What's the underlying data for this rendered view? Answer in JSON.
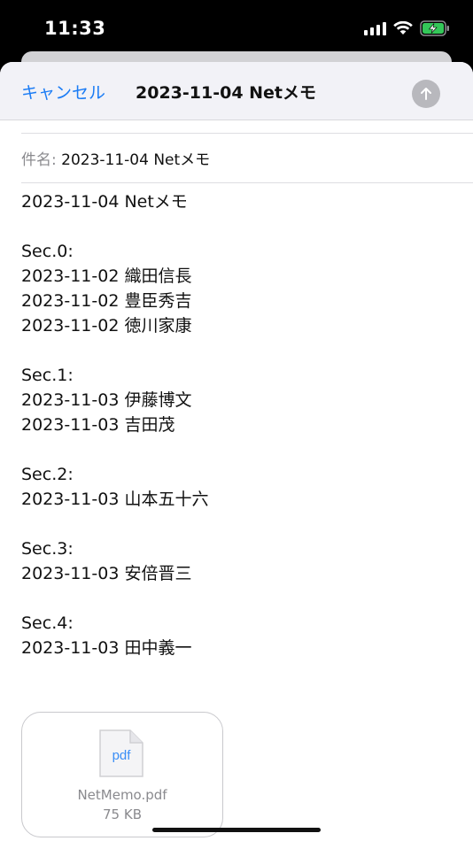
{
  "status_bar": {
    "time": "11:33"
  },
  "nav": {
    "cancel_label": "キャンセル",
    "title": "2023-11-04 Netメモ",
    "send_icon": "arrow-up-icon"
  },
  "subject": {
    "label": "件名:",
    "value": "2023-11-04 Netメモ"
  },
  "body": {
    "title": "2023-11-04 Netメモ",
    "sections": [
      {
        "header": "Sec.0:",
        "lines": [
          "2023-11-02 織田信長",
          "2023-11-02 豊臣秀吉",
          "2023-11-02 徳川家康"
        ]
      },
      {
        "header": "Sec.1:",
        "lines": [
          "2023-11-03 伊藤博文",
          "2023-11-03 吉田茂"
        ]
      },
      {
        "header": "Sec.2:",
        "lines": [
          "2023-11-03 山本五十六"
        ]
      },
      {
        "header": "Sec.3:",
        "lines": [
          "2023-11-03 安倍晋三"
        ]
      },
      {
        "header": "Sec.4:",
        "lines": [
          "2023-11-03 田中義一"
        ]
      }
    ]
  },
  "attachment": {
    "icon_text": "pdf",
    "filename": "NetMemo.pdf",
    "size": "75 KB"
  },
  "colors": {
    "accent": "#1b7cf5",
    "secondary_text": "#8a8a8e"
  }
}
